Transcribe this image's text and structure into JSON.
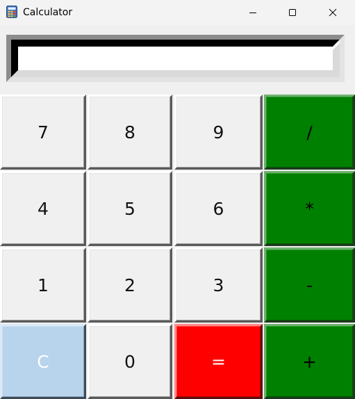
{
  "window": {
    "title": "Calculator",
    "icon": "calculator-icon"
  },
  "titlebar_buttons": {
    "minimize": "minimize-icon",
    "maximize": "maximize-icon",
    "close": "close-icon"
  },
  "display": {
    "value": ""
  },
  "keys": {
    "row1": [
      "7",
      "8",
      "9",
      "/"
    ],
    "row2": [
      "4",
      "5",
      "6",
      "*"
    ],
    "row3": [
      "1",
      "2",
      "3",
      "-"
    ],
    "row4": [
      "C",
      "0",
      "=",
      "+"
    ]
  },
  "colors": {
    "operator": "#008000",
    "clear": "#b8d3ec",
    "equals": "#ff0000",
    "digit": "#f0f0f0"
  }
}
